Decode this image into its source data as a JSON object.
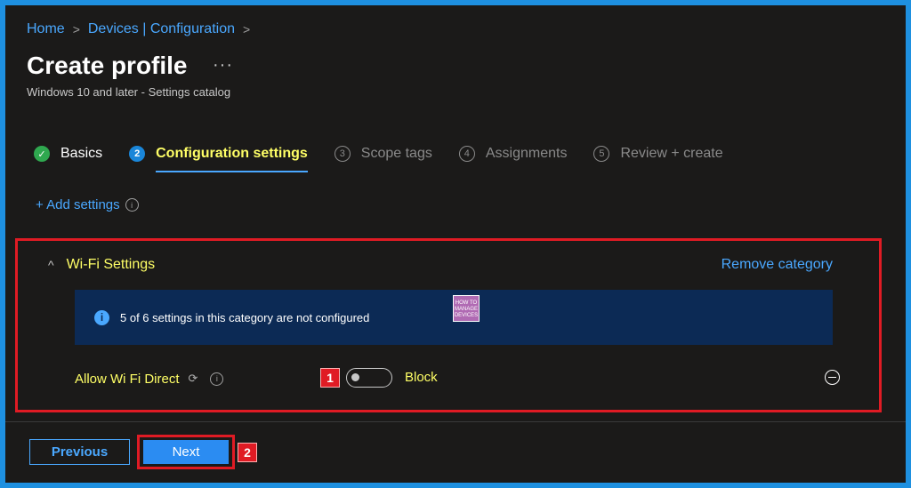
{
  "breadcrumb": {
    "home": "Home",
    "devices": "Devices | Configuration",
    "sep": ">"
  },
  "page": {
    "title": "Create profile",
    "more": "···",
    "subtitle": "Windows 10 and later - Settings catalog"
  },
  "steps": [
    {
      "num": "✓",
      "label": "Basics",
      "state": "done"
    },
    {
      "num": "2",
      "label": "Configuration settings",
      "state": "active"
    },
    {
      "num": "3",
      "label": "Scope tags",
      "state": "pending"
    },
    {
      "num": "4",
      "label": "Assignments",
      "state": "pending"
    },
    {
      "num": "5",
      "label": "Review + create",
      "state": "pending"
    }
  ],
  "add_settings": {
    "label": "+ Add settings",
    "info": "i"
  },
  "category": {
    "chevron": "^",
    "title": "Wi-Fi Settings",
    "remove_label": "Remove category",
    "banner_icon": "i",
    "banner_text": "5 of 6 settings in this category are not configured",
    "watermark": "HOW TO MANAGE DEVICES",
    "setting": {
      "label": "Allow Wi Fi Direct",
      "sync_icon": "⟳",
      "info": "i",
      "badge": "1",
      "toggle_on": false,
      "toggle_label": "Block"
    }
  },
  "footer": {
    "previous_label": "Previous",
    "next_label": "Next",
    "badge": "2"
  },
  "colors": {
    "accent": "#4aa8ff",
    "highlight_text": "#ffff66",
    "annotation_red": "#e01b24",
    "banner_bg": "#0c2a55",
    "success": "#2fa84f"
  }
}
